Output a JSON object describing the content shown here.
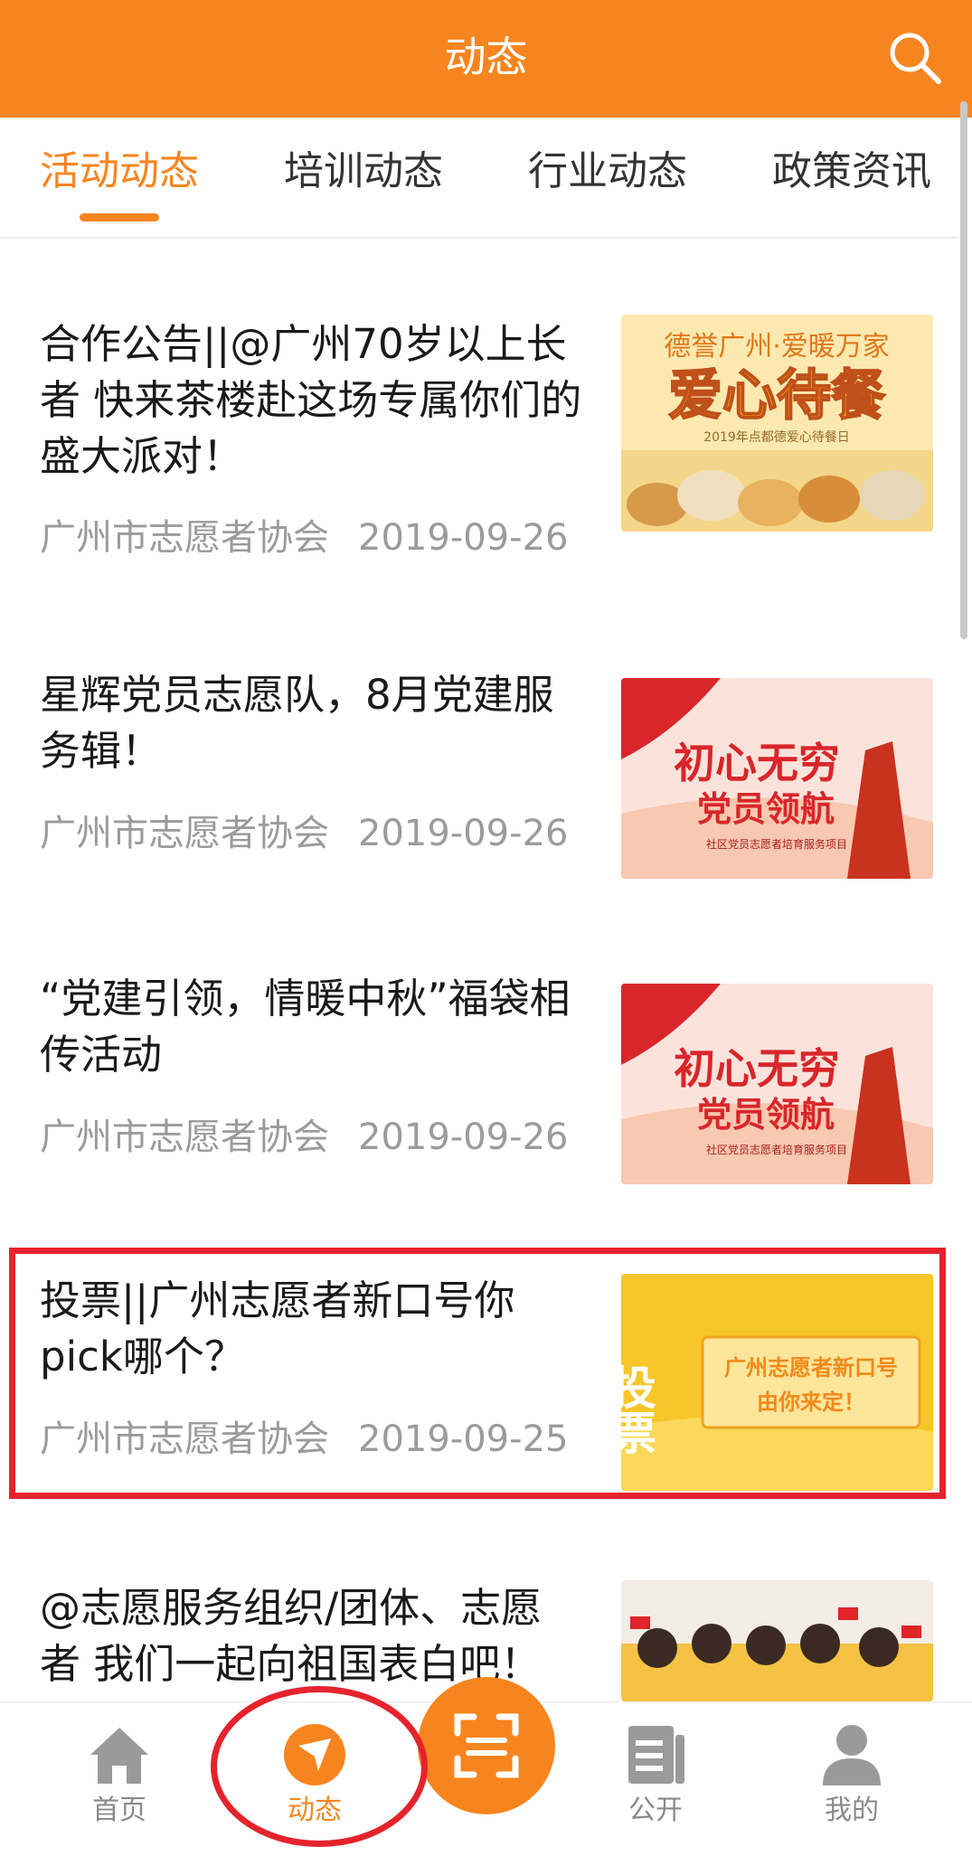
{
  "header": {
    "title": "动态",
    "search_icon": "search-icon"
  },
  "tabs": [
    {
      "label": "活动动态",
      "active": true
    },
    {
      "label": "培训动态",
      "active": false
    },
    {
      "label": "行业动态",
      "active": false
    },
    {
      "label": "政策资讯",
      "active": false
    }
  ],
  "news": [
    {
      "title": "合作公告||@广州70岁以上长者 快来茶楼赴这场专属你们的盛大派对！",
      "source": "广州市志愿者协会",
      "date": "2019-09-26"
    },
    {
      "title": "星辉党员志愿队，8月党建服务辑！",
      "source": "广州市志愿者协会",
      "date": "2019-09-26"
    },
    {
      "title": "“党建引领，情暖中秋”福袋相传活动",
      "source": "广州市志愿者协会",
      "date": "2019-09-26"
    },
    {
      "title": "投票||广州志愿者新口号你pick哪个？",
      "source": "广州市志愿者协会",
      "date": "2019-09-25"
    },
    {
      "title": "@志愿服务组织/团体、志愿者 我们一起向祖国表白吧！",
      "source": "",
      "date": ""
    }
  ],
  "thumbs": {
    "t1_top": "德誉广州·爱暖万家",
    "t1_main": "爱心待餐",
    "t1_sub": "2019年点都德爱心待餐日",
    "t2_main1": "初心无穷",
    "t2_main2": "党员领航",
    "t2_sub": "社区党员志愿者培育服务项目",
    "t4_left": "投票",
    "t4_line1": "广州志愿者新口号",
    "t4_line2": "由你来定！"
  },
  "bottom_nav": [
    {
      "label": "首页",
      "icon": "home-icon",
      "active": false
    },
    {
      "label": "动态",
      "icon": "send-icon",
      "active": true
    },
    {
      "label": "公开",
      "icon": "document-icon",
      "active": false
    },
    {
      "label": "我的",
      "icon": "user-icon",
      "active": false
    }
  ],
  "colors": {
    "brand": "#f7851f",
    "highlight": "#e5232d"
  }
}
